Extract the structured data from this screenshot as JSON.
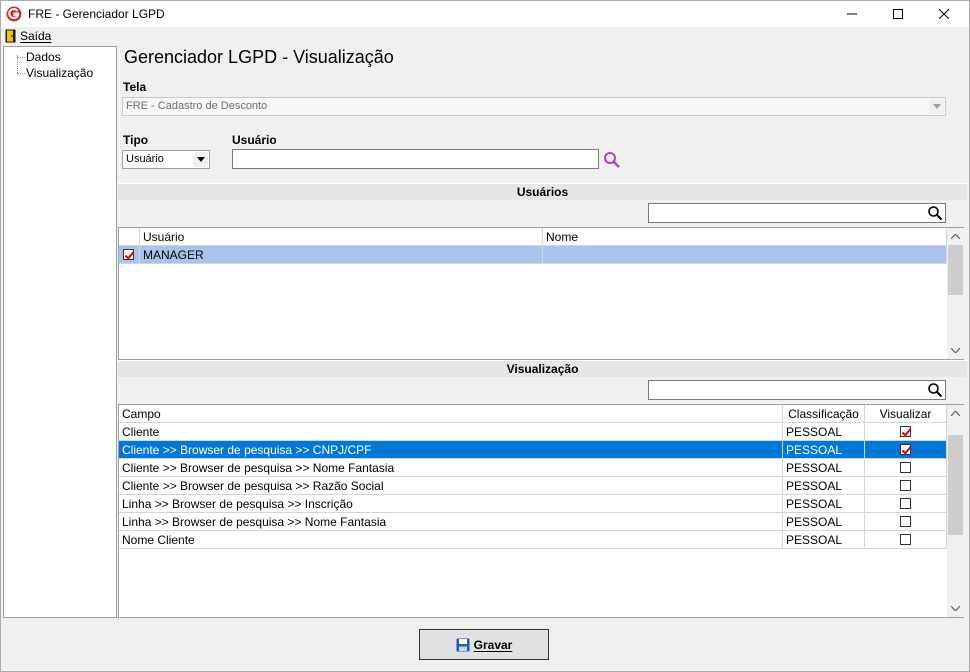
{
  "window": {
    "title": "FRE - Gerenciador LGPD"
  },
  "menu": {
    "saida_label": "Saída"
  },
  "tree": {
    "items": [
      "Dados",
      "Visualização"
    ]
  },
  "page": {
    "title": "Gerenciador LGPD - Visualização"
  },
  "tela": {
    "label": "Tela",
    "value": "FRE - Cadastro de Desconto"
  },
  "tipo": {
    "label": "Tipo",
    "value": "Usuário"
  },
  "usuario": {
    "label": "Usuário",
    "value": ""
  },
  "usuarios_section": {
    "title": "Usuários",
    "search_value": "",
    "columns": [
      "Usuário",
      "Nome"
    ],
    "rows": [
      {
        "checked": true,
        "usuario": "MANAGER",
        "nome": ""
      }
    ]
  },
  "visualizacao_section": {
    "title": "Visualização",
    "search_value": "",
    "columns": [
      "Campo",
      "Classificação",
      "Visualizar"
    ],
    "rows": [
      {
        "campo": "Cliente",
        "classificacao": "PESSOAL",
        "visualizar": true
      },
      {
        "campo": "Cliente >> Browser de pesquisa >> CNPJ/CPF",
        "classificacao": "PESSOAL",
        "visualizar": true
      },
      {
        "campo": "Cliente >> Browser de pesquisa >> Nome Fantasia",
        "classificacao": "PESSOAL",
        "visualizar": false
      },
      {
        "campo": "Cliente >> Browser de pesquisa >> Razão Social",
        "classificacao": "PESSOAL",
        "visualizar": false
      },
      {
        "campo": "Linha >> Browser de pesquisa >> Inscrição",
        "classificacao": "PESSOAL",
        "visualizar": false
      },
      {
        "campo": "Linha >> Browser de pesquisa >> Nome Fantasia",
        "classificacao": "PESSOAL",
        "visualizar": false
      },
      {
        "campo": "Nome Cliente",
        "classificacao": "PESSOAL",
        "visualizar": false
      }
    ]
  },
  "buttons": {
    "gravar": "Gravar"
  },
  "colors": {
    "selection": "#0078d7",
    "selection_light": "#a8c4ec",
    "check": "#dd0000",
    "logo": "#d42a2a",
    "search_icon": "#b040c0"
  }
}
